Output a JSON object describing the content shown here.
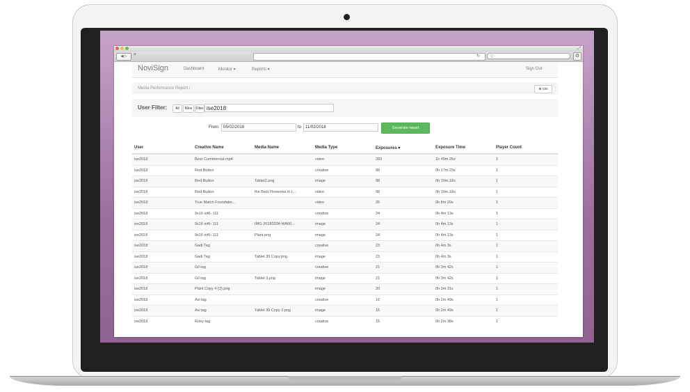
{
  "browser": {
    "back_label": "◀ ▷",
    "new_tab_label": "+",
    "search_placeholder": "Q~"
  },
  "navbar": {
    "brand": "NoviSign",
    "links": [
      "Dashboard",
      "Monitor ▾",
      "Reports ▾"
    ],
    "sign_out": "Sign Out"
  },
  "breadcrumb": {
    "text": "Media Performance Report  /",
    "csv_label": "⊕ csv"
  },
  "user_filter": {
    "label": "User Filter:",
    "buttons": [
      "All",
      "Mine",
      "Filter"
    ],
    "value": "ise2018"
  },
  "date_range": {
    "from_label": "From",
    "from_value": "05/02/2018",
    "to_label": "to",
    "to_value": "11/02/2018",
    "generate_label": "Generate report"
  },
  "table": {
    "headers": [
      "User",
      "Creative Name",
      "Media Name",
      "Media Type",
      "Exposures ▾",
      "Exposure Time",
      "Player Count"
    ],
    "rows": [
      [
        "ise2018",
        "Beer Commercial.mp4",
        "",
        "video",
        "260",
        "1h 45m 25s",
        "1"
      ],
      [
        "ise2018",
        "Red Button",
        "",
        "creative",
        "98",
        "0h 17m 23s",
        "1"
      ],
      [
        "ise2018",
        "Red Button",
        "Tablet2.png",
        "image",
        "98",
        "0h 19m 18s",
        "1"
      ],
      [
        "ise2018",
        "Red Button",
        "the Best Fireworks in t...",
        "video",
        "98",
        "0h 19m 18s",
        "1"
      ],
      [
        "ise2018",
        "True Match Foundatio...",
        "",
        "video",
        "25",
        "0h 8m 20s",
        "1"
      ],
      [
        "ise2018",
        "9x16 iot6- 111",
        "",
        "creative",
        "24",
        "0h 4m 13s",
        "1"
      ],
      [
        "ise2018",
        "9x16 iot6- 111",
        "IMG-20180204-WA00...",
        "image",
        "24",
        "0h 4m 13s",
        "1"
      ],
      [
        "ise2018",
        "9x16 iot6- 111",
        "Plant.png",
        "image",
        "24",
        "0h 4m 13s",
        "1"
      ],
      [
        "ise2018",
        "Gadi Tag",
        "",
        "creative",
        "23",
        "0h 4m 3s",
        "1"
      ],
      [
        "ise2018",
        "Gadi Tag",
        "Tablet 35 Copy.png",
        "image",
        "23",
        "0h 4m 3s",
        "1"
      ],
      [
        "ise2018",
        "Gil tag",
        "",
        "creative",
        "21",
        "0h 3m 42s",
        "1"
      ],
      [
        "ise2018",
        "Gil tag",
        "Tablet 3.png",
        "image",
        "21",
        "0h 3m 42s",
        "1"
      ],
      [
        "ise2018",
        "Plant Copy 4 (2).png",
        "",
        "image",
        "20",
        "0h 3m 31s",
        "1"
      ],
      [
        "ise2018",
        "Avi tag",
        "",
        "creative",
        "16",
        "0h 2m 49s",
        "1"
      ],
      [
        "ise2018",
        "Avi tag",
        "Tablet 35 Copy 2.png",
        "image",
        "16",
        "0h 2m 49s",
        "1"
      ],
      [
        "ise2018",
        "Roey tag",
        "",
        "creative",
        "15",
        "0h 2m 38s",
        "1"
      ]
    ]
  },
  "colors": {
    "generate_button": "#5cb85c",
    "wallpaper": "#9c6e9f"
  }
}
